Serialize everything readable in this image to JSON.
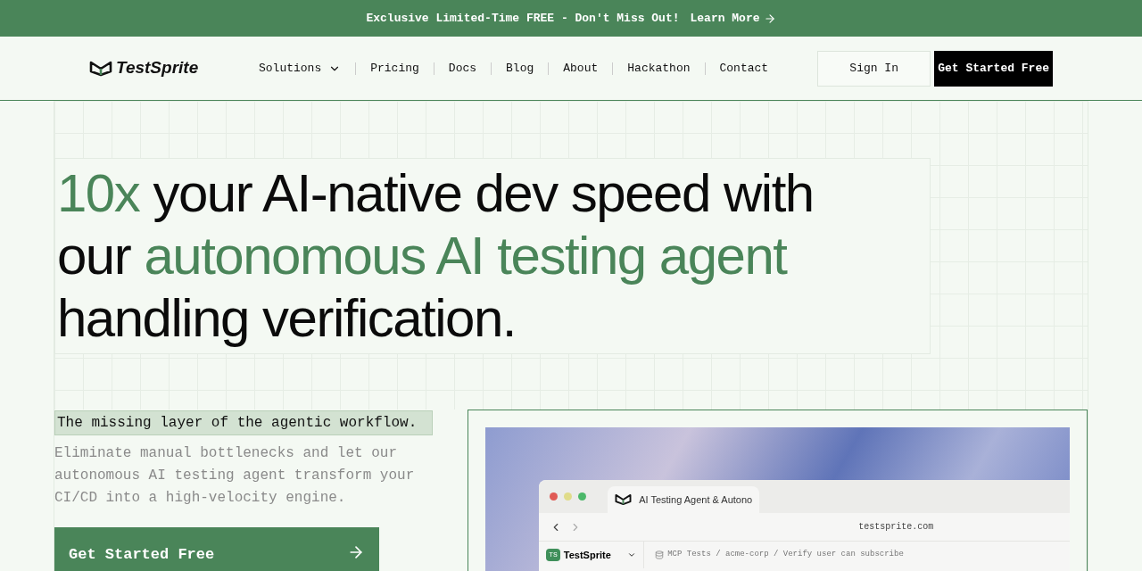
{
  "announcement": {
    "text": "Exclusive Limited-Time FREE - Don't Miss Out!",
    "link": "Learn More"
  },
  "nav": {
    "logo": "TestSprite",
    "links": [
      {
        "label": "Solutions",
        "dropdown": true
      },
      {
        "label": "Pricing",
        "dropdown": false
      },
      {
        "label": "Docs",
        "dropdown": false
      },
      {
        "label": "Blog",
        "dropdown": false
      },
      {
        "label": "About",
        "dropdown": false
      },
      {
        "label": "Hackathon",
        "dropdown": false
      },
      {
        "label": "Contact",
        "dropdown": false
      }
    ],
    "sign_in": "Sign In",
    "cta": "Get Started Free"
  },
  "hero": {
    "headline": [
      [
        {
          "text": "10x",
          "accent": true
        },
        {
          "text": " your AI-native dev speed with",
          "accent": false
        }
      ],
      [
        {
          "text": "our ",
          "accent": false
        },
        {
          "text": "autonomous AI testing agent",
          "accent": true
        }
      ],
      [
        {
          "text": "handling verification.",
          "accent": false
        }
      ]
    ],
    "tagline": "The missing layer of the agentic workflow.",
    "description": "Eliminate manual bottlenecks and let our autonomous AI testing agent transform your CI/CD into a high-velocity engine.",
    "cta": "Get Started Free"
  },
  "preview": {
    "tab_title": "AI Testing Agent & Autono",
    "url": "testsprite.com",
    "workspace_badge": "TS",
    "workspace": "TestSprite",
    "breadcrumb": "MCP Tests / acme-corp / Verify user can subscribe"
  }
}
